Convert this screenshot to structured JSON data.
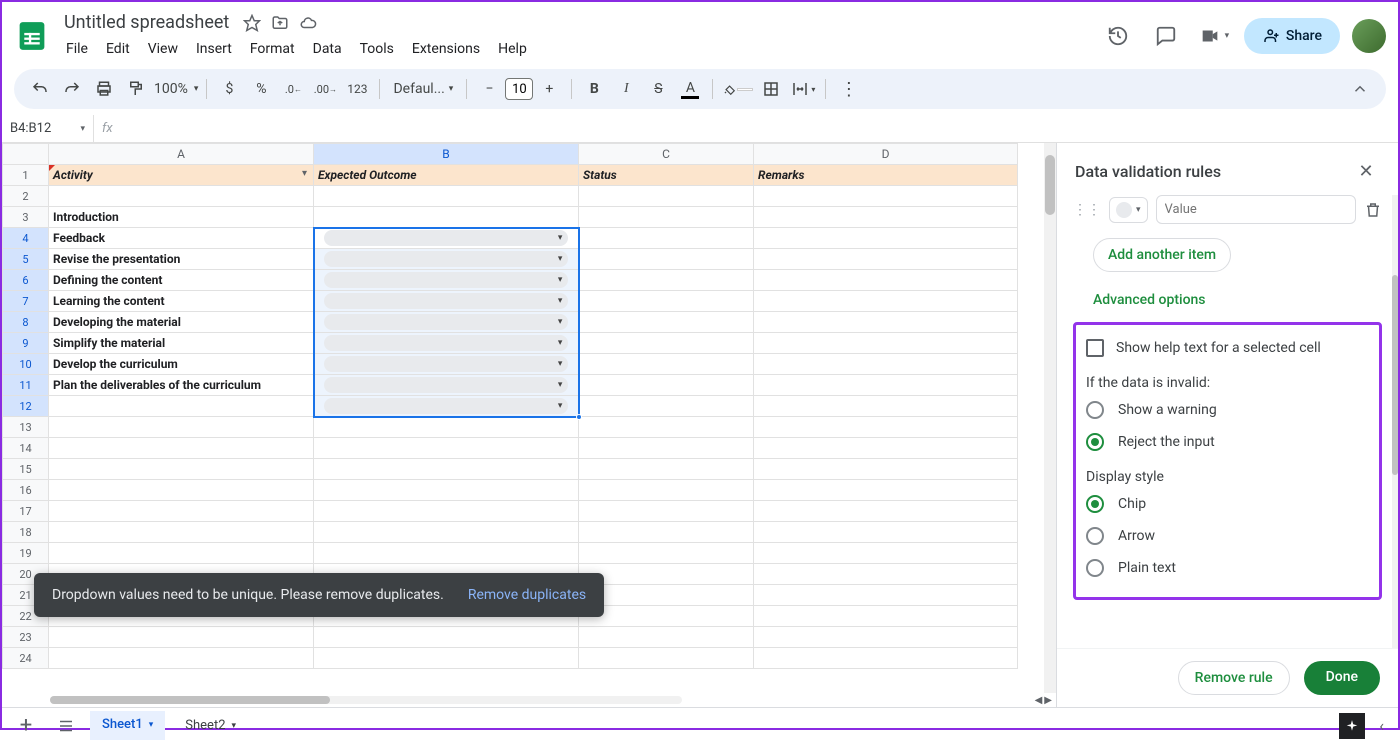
{
  "header": {
    "doc_title": "Untitled spreadsheet",
    "menus": [
      "File",
      "Edit",
      "View",
      "Insert",
      "Format",
      "Data",
      "Tools",
      "Extensions",
      "Help"
    ],
    "share_label": "Share"
  },
  "toolbar": {
    "zoom": "100%",
    "font_name": "Defaul...",
    "font_size": "10"
  },
  "namebox": {
    "range": "B4:B12",
    "fx": "fx"
  },
  "columns": [
    "A",
    "B",
    "C",
    "D"
  ],
  "header_row": {
    "activity": "Activity",
    "expected": "Expected Outcome",
    "status": "Status",
    "remarks": "Remarks"
  },
  "rows_a": [
    "",
    "Introduction",
    "Feedback",
    "Revise the presentation",
    "Defining the content",
    "Learning the content",
    "Developing the material",
    "Simplify the material",
    "Develop the curriculum",
    "Plan the deliverables of the curriculum"
  ],
  "toast": {
    "message": "Dropdown values need to be unique. Please remove duplicates.",
    "action": "Remove duplicates"
  },
  "sidebar": {
    "title": "Data validation rules",
    "value_placeholder": "Value",
    "add_item": "Add another item",
    "advanced": "Advanced options",
    "help_text": "Show help text for a selected cell",
    "invalid_label": "If the data is invalid:",
    "invalid_opts": {
      "warn": "Show a warning",
      "reject": "Reject the input"
    },
    "display_label": "Display style",
    "display_opts": {
      "chip": "Chip",
      "arrow": "Arrow",
      "plain": "Plain text"
    },
    "remove": "Remove rule",
    "done": "Done"
  },
  "sheets": {
    "s1": "Sheet1",
    "s2": "Sheet2"
  },
  "icons": {
    "currency": "$",
    "percent": "%",
    "decrease_dec": ".0",
    "increase_dec": ".00",
    "format_123": "123",
    "minus": "−",
    "plus": "+",
    "bold": "B",
    "italic": "I",
    "strike": "S",
    "letter_a": "A"
  }
}
